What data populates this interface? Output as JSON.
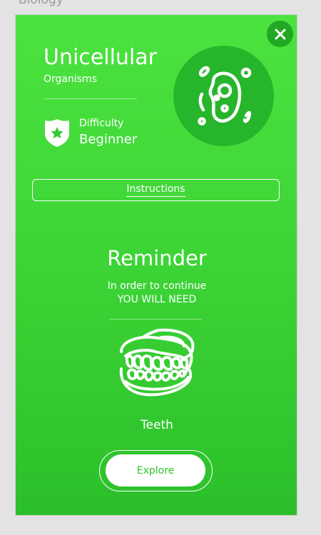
{
  "header": {
    "category": "Biology"
  },
  "card": {
    "title": "Unicellular",
    "subtitle": "Organisms",
    "difficulty_label": "Difficulty",
    "difficulty_value": "Beginner",
    "instructions_label": "Instructions",
    "reminder_title": "Reminder",
    "reminder_line1": "In order to continue",
    "reminder_line2": "YOU WILL NEED",
    "required_item": "Teeth",
    "explore_label": "Explore"
  },
  "icons": {
    "close": "close-icon",
    "badge": "shield-star-icon",
    "organism": "cell-organism-icon",
    "item": "teeth-icon"
  },
  "colors": {
    "card_green": "#44dc3a",
    "dark_green": "#24ad27",
    "white": "#ffffff",
    "explore_text": "#2fc22c"
  }
}
